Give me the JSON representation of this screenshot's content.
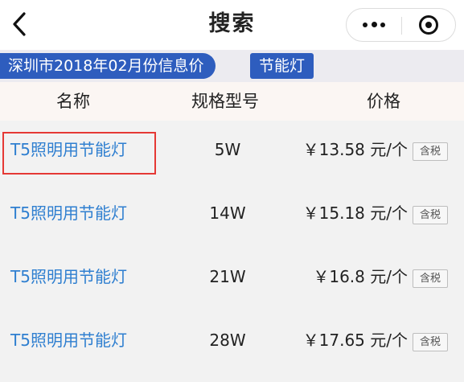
{
  "header": {
    "title": "搜索",
    "back_icon": "chevron-left-icon",
    "more_icon": "more-dots-icon",
    "close_icon": "target-circle-icon"
  },
  "tags": {
    "period": "深圳市2018年02月份信息价",
    "keyword": "节能灯"
  },
  "columns": {
    "name": "名称",
    "spec": "规格型号",
    "price": "价格"
  },
  "rows": [
    {
      "name": "T5照明用节能灯",
      "spec": "5W",
      "price": "￥13.58 元/个",
      "tax": "含税"
    },
    {
      "name": "T5照明用节能灯",
      "spec": "14W",
      "price": "￥15.18 元/个",
      "tax": "含税"
    },
    {
      "name": "T5照明用节能灯",
      "spec": "21W",
      "price": "￥16.8 元/个",
      "tax": "含税"
    },
    {
      "name": "T5照明用节能灯",
      "spec": "28W",
      "price": "￥17.65 元/个",
      "tax": "含税"
    }
  ],
  "colors": {
    "accent": "#2e5dbe",
    "link": "#2f7fd0",
    "highlight": "#e53935"
  }
}
